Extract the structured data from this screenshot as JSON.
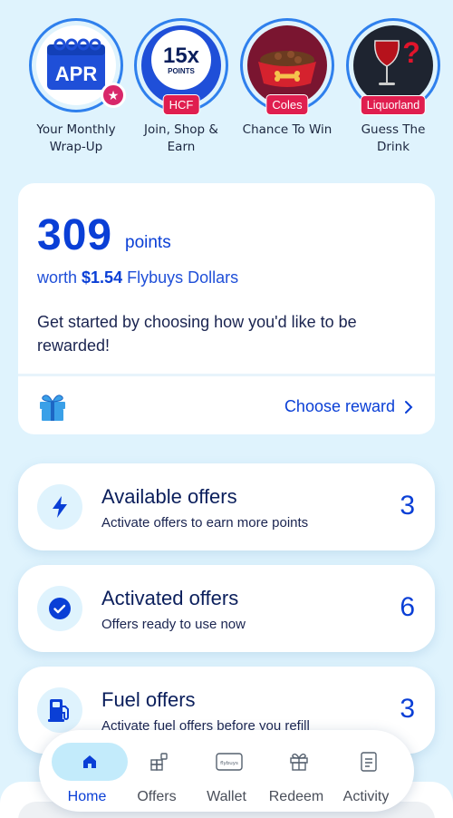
{
  "stories": [
    {
      "caption_line1": "Your Monthly",
      "caption_line2": "Wrap-Up",
      "badge_text": "APR",
      "icon": "calendar-icon"
    },
    {
      "caption_line1": "Join, Shop &",
      "caption_line2": "Earn",
      "badge_num": "15x",
      "badge_sub": "POINTS",
      "tag": "HCF"
    },
    {
      "caption_line1": "Chance To Win",
      "caption_line2": "",
      "tag": "Coles",
      "icon": "pet-bowl-icon"
    },
    {
      "caption_line1": "Guess The",
      "caption_line2": "Drink",
      "tag": "Liquorland",
      "icon": "wine-glass-icon"
    }
  ],
  "points": {
    "value": "309",
    "unit": "points",
    "worth_prefix": "worth",
    "worth_amount": "$1.54",
    "worth_suffix": "Flybuys Dollars",
    "message": "Get started by choosing how you'd like to be rewarded!",
    "choose_reward": "Choose reward"
  },
  "offers": [
    {
      "title": "Available offers",
      "subtitle": "Activate offers to earn more points",
      "count": "3",
      "icon": "lightning-icon"
    },
    {
      "title": "Activated offers",
      "subtitle": "Offers ready to use now",
      "count": "6",
      "icon": "check-circle-icon"
    },
    {
      "title": "Fuel offers",
      "subtitle": "Activate fuel offers before you refill",
      "count": "3",
      "icon": "fuel-pump-icon"
    }
  ],
  "nav": [
    {
      "label": "Home",
      "active": true
    },
    {
      "label": "Offers",
      "active": false
    },
    {
      "label": "Wallet",
      "active": false,
      "card_text": "flybuys"
    },
    {
      "label": "Redeem",
      "active": false
    },
    {
      "label": "Activity",
      "active": false
    }
  ],
  "colors": {
    "accent": "#0a3fd6",
    "background": "#dff3fd",
    "tag": "#e01e4f"
  }
}
